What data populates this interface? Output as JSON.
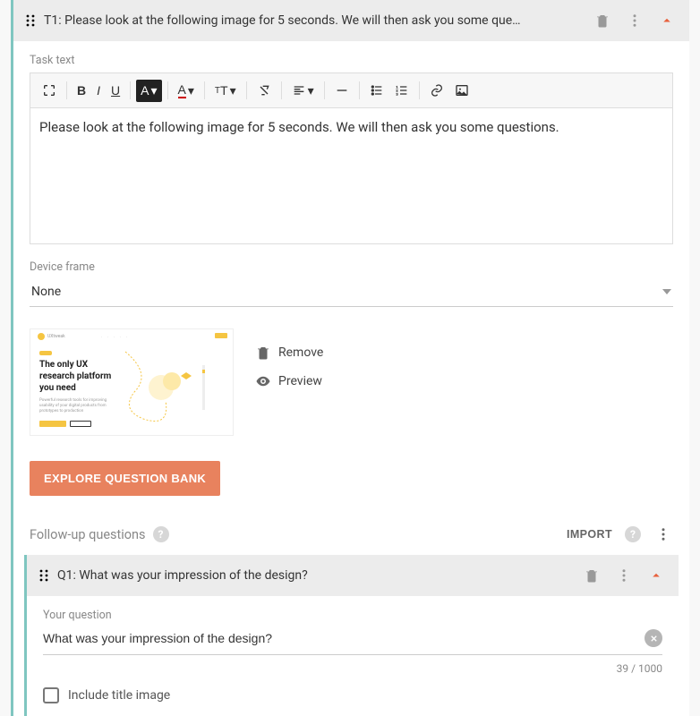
{
  "task": {
    "header_title": "T1: Please look at the following image for 5 seconds. We will then ask you some que…",
    "task_text_label": "Task text",
    "editor_content": "Please look at the following image for 5 seconds. We will then ask you some questions.",
    "device_frame_label": "Device frame",
    "device_frame_value": "None",
    "thumbnail": {
      "logo_text": "UXtweak",
      "title_line1": "The only UX",
      "title_line2": "research platform",
      "title_line3": "you need",
      "subtitle": "Powerful research tools for improving usability of your digital products from prototypes to production"
    },
    "thumb_actions": {
      "remove": "Remove",
      "preview": "Preview"
    },
    "explore_button": "EXPLORE QUESTION BANK"
  },
  "followup": {
    "label": "Follow-up questions",
    "import_label": "IMPORT"
  },
  "question": {
    "header_title": "Q1: What was your impression of the design?",
    "your_question_label": "Your question",
    "input_value": "What was your impression of the design?",
    "char_count": "39 / 1000",
    "include_title_image_label": "Include title image"
  }
}
